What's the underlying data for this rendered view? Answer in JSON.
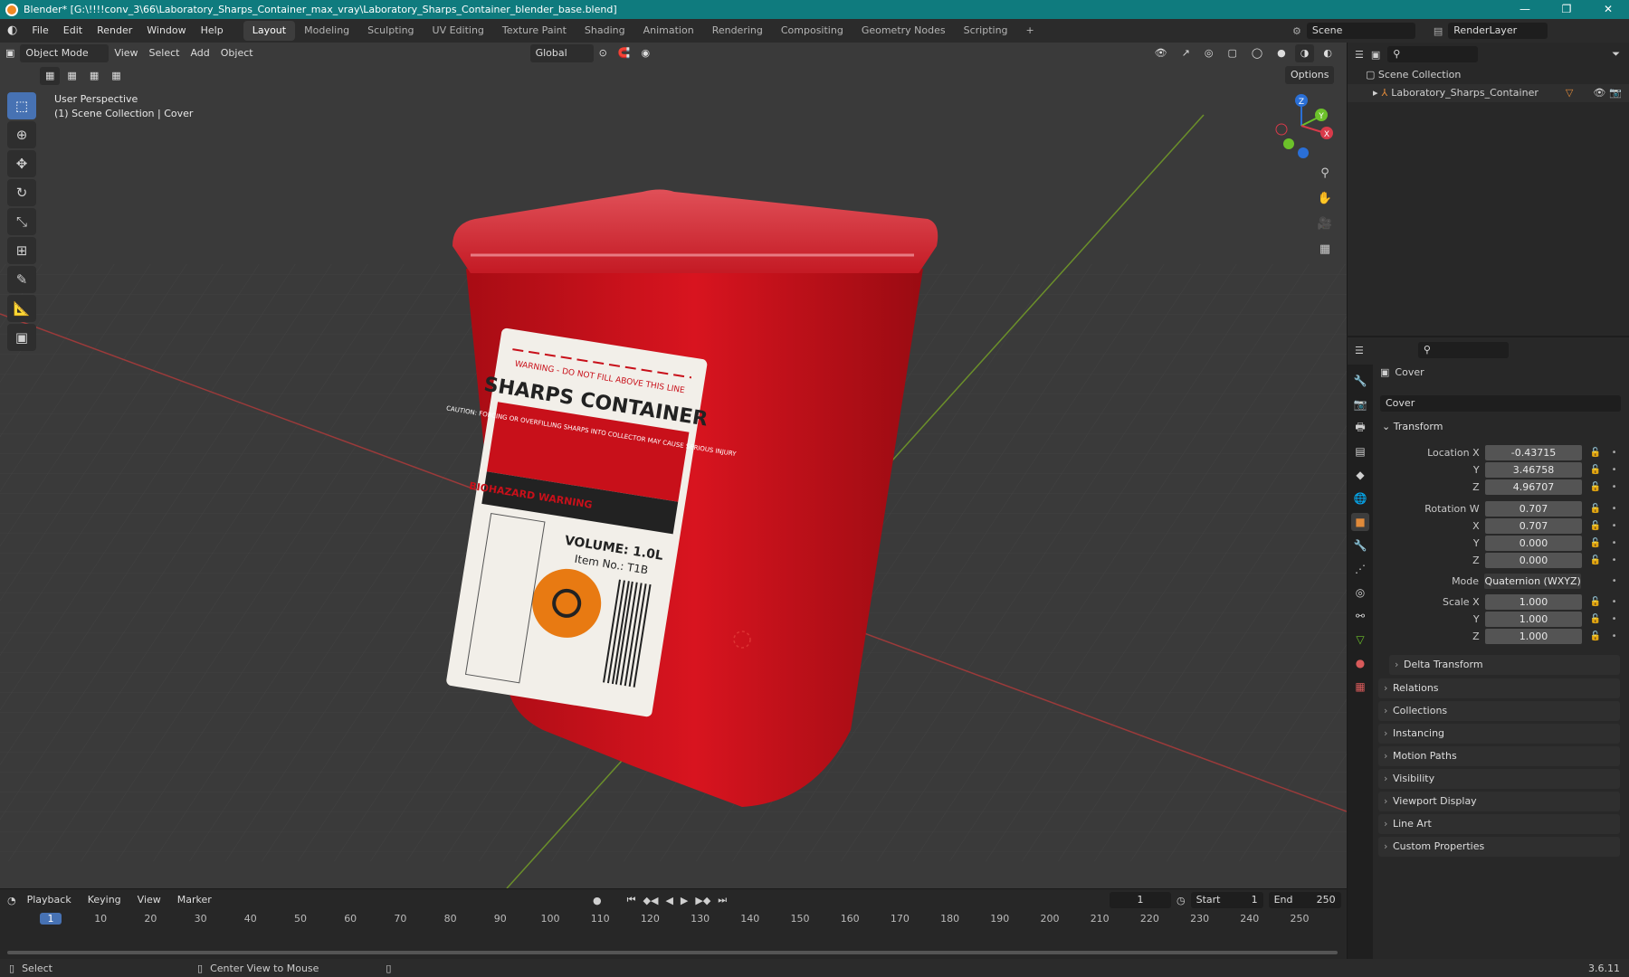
{
  "window": {
    "title": "Blender* [G:\\!!!!conv_3\\66\\Laboratory_Sharps_Container_max_vray\\Laboratory_Sharps_Container_blender_base.blend]",
    "controls": [
      "—",
      "❐",
      "✕"
    ]
  },
  "menubar": {
    "items": [
      "File",
      "Edit",
      "Render",
      "Window",
      "Help"
    ],
    "workspaces": [
      "Layout",
      "Modeling",
      "Sculpting",
      "UV Editing",
      "Texture Paint",
      "Shading",
      "Animation",
      "Rendering",
      "Compositing",
      "Geometry Nodes",
      "Scripting"
    ],
    "active_workspace": "Layout",
    "add_tab": "+",
    "scene": "Scene",
    "view_layer": "RenderLayer"
  },
  "viewport_header": {
    "mode": "Object Mode",
    "menus": [
      "View",
      "Select",
      "Add",
      "Object"
    ],
    "orientation": "Global",
    "options": "Options"
  },
  "viewport": {
    "perspective": "User Perspective",
    "collection_info": "(1) Scene Collection | Cover",
    "gizmo_axes": [
      "Z",
      "Y",
      "X"
    ],
    "object": {
      "label_warning": "WARNING - DO NOT FILL ABOVE THIS LINE",
      "label_title": "SHARPS CONTAINER",
      "label_caution": "CAUTION: FORCING OR OVERFILLING SHARPS INTO COLLECTOR MAY CAUSE SERIOUS INJURY",
      "label_biohazard": "BIOHAZARD WARNING",
      "label_volume": "VOLUME: 1.0L",
      "label_item": "Item No.: T1B",
      "colors": {
        "body": "#c8101a",
        "label": "#f2efe9",
        "hazard": "#e87a12"
      }
    }
  },
  "outliner": {
    "root": "Scene Collection",
    "items": [
      {
        "label": "Laboratory_Sharps_Container"
      }
    ]
  },
  "properties": {
    "object_name": "Cover",
    "data_name": "Cover",
    "transform": {
      "title": "Transform",
      "rows": [
        {
          "label": "Location X",
          "value": "-0.43715"
        },
        {
          "label": "Y",
          "value": "3.46758"
        },
        {
          "label": "Z",
          "value": "4.96707"
        },
        {
          "label": "Rotation W",
          "value": "0.707"
        },
        {
          "label": "X",
          "value": "0.707"
        },
        {
          "label": "Y",
          "value": "0.000"
        },
        {
          "label": "Z",
          "value": "0.000"
        },
        {
          "label": "Mode",
          "value": "Quaternion (WXYZ)"
        },
        {
          "label": "Scale X",
          "value": "1.000"
        },
        {
          "label": "Y",
          "value": "1.000"
        },
        {
          "label": "Z",
          "value": "1.000"
        }
      ],
      "delta": "Delta Transform"
    },
    "sections": [
      "Relations",
      "Collections",
      "Instancing",
      "Motion Paths",
      "Visibility",
      "Viewport Display",
      "Line Art",
      "Custom Properties"
    ]
  },
  "timeline": {
    "menus": [
      "Playback",
      "Keying",
      "View",
      "Marker"
    ],
    "current_frame": "1",
    "start_label": "Start",
    "start": "1",
    "end_label": "End",
    "end": "250",
    "ticks": [
      "1",
      "10",
      "20",
      "30",
      "40",
      "50",
      "60",
      "70",
      "80",
      "90",
      "100",
      "110",
      "120",
      "130",
      "140",
      "150",
      "160",
      "170",
      "180",
      "190",
      "200",
      "210",
      "220",
      "230",
      "240",
      "250"
    ]
  },
  "statusbar": {
    "select": "Select",
    "center": "Center View to Mouse",
    "version": "3.6.11"
  }
}
